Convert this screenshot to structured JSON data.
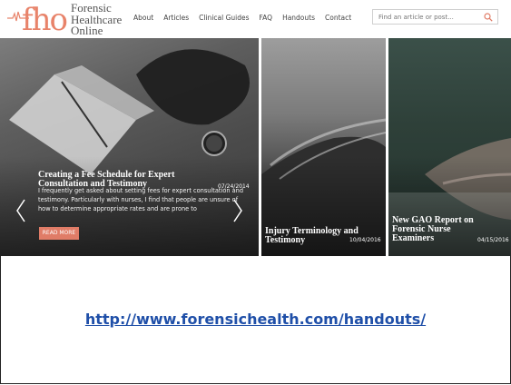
{
  "logo": {
    "mark": "fho",
    "line1": "Forensic",
    "line2": "Healthcare",
    "line3": "Online"
  },
  "nav": {
    "items": [
      "About",
      "Articles",
      "Clinical Guides",
      "FAQ",
      "Handouts",
      "Contact"
    ]
  },
  "search": {
    "placeholder": "Find an article or post..."
  },
  "slides": [
    {
      "title_l1": "Creating a Fee Schedule for Expert",
      "title_l2": "Consultation and Testimony",
      "date": "07/24/2014",
      "excerpt": "I frequently get asked about setting fees for expert consultation and testimony. Particularly with nurses, I find that people are unsure of how to determine appropriate rates and are prone to",
      "read_more": "READ MORE"
    },
    {
      "title_l1": "Injury Terminology and",
      "title_l2": "Testimony",
      "date": "10/04/2016"
    },
    {
      "title_l1": "New GAO Report on",
      "title_l2": "Forensic Nurse",
      "title_l3": "Examiners",
      "date": "04/15/2016"
    }
  ],
  "footer_link": {
    "text": "http://www.forensichealth.com/handouts/"
  },
  "colors": {
    "accent": "#e07c67",
    "link": "#1f4fa8"
  },
  "icons": [
    "search-icon",
    "chevron-left-icon",
    "chevron-right-icon",
    "heartbeat-icon"
  ]
}
